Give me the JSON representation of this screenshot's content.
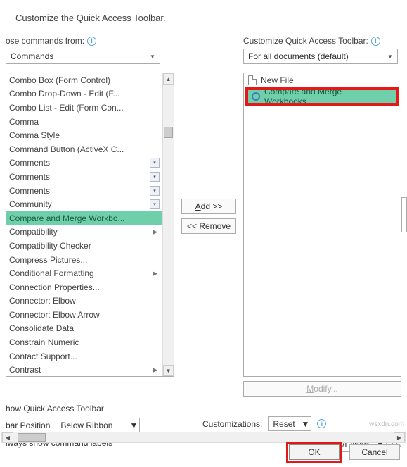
{
  "title": "Customize the Quick Access Toolbar.",
  "left": {
    "choose_label": "ose commands from:",
    "dropdown": "Commands",
    "items": [
      {
        "label": "Combo Box (Form Control)",
        "submenu": false,
        "dd": false
      },
      {
        "label": "Combo Drop-Down - Edit (F...",
        "submenu": false,
        "dd": false
      },
      {
        "label": "Combo List - Edit (Form Con...",
        "submenu": false,
        "dd": false
      },
      {
        "label": "Comma",
        "submenu": false,
        "dd": false
      },
      {
        "label": "Comma Style",
        "submenu": false,
        "dd": false
      },
      {
        "label": "Command Button (ActiveX C...",
        "submenu": false,
        "dd": false
      },
      {
        "label": "Comments",
        "submenu": false,
        "dd": true
      },
      {
        "label": "Comments",
        "submenu": false,
        "dd": true
      },
      {
        "label": "Comments",
        "submenu": false,
        "dd": true
      },
      {
        "label": "Community",
        "submenu": false,
        "dd": true
      },
      {
        "label": "Compare and Merge Workbo...",
        "submenu": false,
        "dd": false,
        "selected": true
      },
      {
        "label": "Compatibility",
        "submenu": true,
        "dd": false
      },
      {
        "label": "Compatibility Checker",
        "submenu": false,
        "dd": false
      },
      {
        "label": "Compress Pictures...",
        "submenu": false,
        "dd": false
      },
      {
        "label": "Conditional Formatting",
        "submenu": true,
        "dd": false
      },
      {
        "label": "Connection Properties...",
        "submenu": false,
        "dd": false
      },
      {
        "label": "Connector: Elbow",
        "submenu": false,
        "dd": false
      },
      {
        "label": "Connector: Elbow Arrow",
        "submenu": false,
        "dd": false
      },
      {
        "label": "Consolidate Data",
        "submenu": false,
        "dd": false
      },
      {
        "label": "Constrain Numeric",
        "submenu": false,
        "dd": false
      },
      {
        "label": "Contact Support...",
        "submenu": false,
        "dd": false
      },
      {
        "label": "Contrast",
        "submenu": true,
        "dd": false
      }
    ]
  },
  "right": {
    "customize_label": "Customize Quick Access Toolbar:",
    "dropdown": "For all documents (default)",
    "items": [
      {
        "label": "New File",
        "icon": "file",
        "selected": false
      },
      {
        "label": "Compare and Merge Workbooks...",
        "icon": "ring",
        "selected": true
      }
    ],
    "modify_label": "Modify..."
  },
  "mid": {
    "add_label": "Add >>",
    "remove_label": "<< Remove"
  },
  "bottom": {
    "show_toolbar_label": "how Quick Access Toolbar",
    "position_label": "bar Position",
    "position_value": "Below Ribbon",
    "always_show_label": "lways show command labels",
    "customizations_label": "Customizations:",
    "reset_label": "Reset",
    "import_export_label": "Import/Export"
  },
  "footer": {
    "ok": "OK",
    "cancel": "Cancel"
  }
}
